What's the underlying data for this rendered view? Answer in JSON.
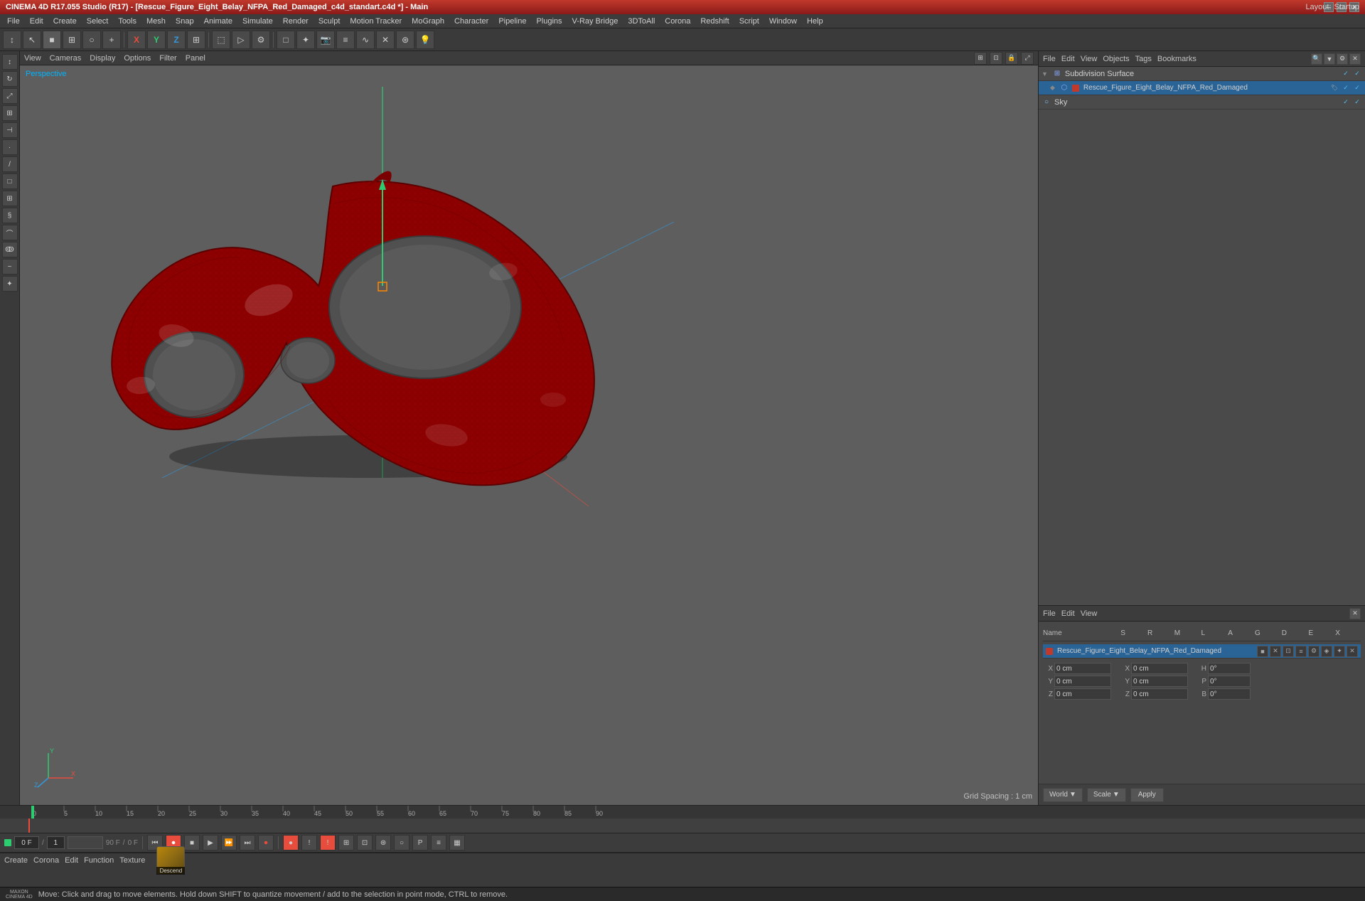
{
  "title_bar": {
    "title": "CINEMA 4D R17.055 Studio (R17) - [Rescue_Figure_Eight_Belay_NFPA_Red_Damaged_c4d_standart.c4d *] - Main",
    "layout_label": "Layout:",
    "layout_value": "Startup"
  },
  "menu_bar": {
    "items": [
      "File",
      "Edit",
      "Create",
      "Select",
      "Tools",
      "Mesh",
      "Snap",
      "Animate",
      "Simulate",
      "Render",
      "Sculpt",
      "Motion Tracker",
      "MoGraph",
      "Character",
      "Pipeline",
      "Plugins",
      "V-Ray Bridge",
      "3DToAll",
      "Corona",
      "Redshift",
      "Script",
      "Window",
      "Help"
    ]
  },
  "viewport": {
    "header_items": [
      "View",
      "Cameras",
      "Display",
      "Options",
      "Filter",
      "Panel"
    ],
    "perspective_label": "Perspective",
    "grid_spacing": "Grid Spacing : 1 cm"
  },
  "right_panel_top": {
    "header_items": [
      "File",
      "Edit",
      "View",
      "Objects",
      "Tags",
      "Bookmarks"
    ],
    "object_tree": {
      "items": [
        {
          "name": "Subdivision Surface",
          "indent": 0,
          "icon": "▽",
          "color": null,
          "active": true
        },
        {
          "name": "Rescue_Figure_Eight_Belay_NFPA_Red_Damaged",
          "indent": 1,
          "icon": "◆",
          "color": "#c0392b",
          "active": true
        },
        {
          "name": "Sky",
          "indent": 0,
          "icon": "○",
          "color": null,
          "active": true
        }
      ]
    }
  },
  "right_panel_bottom": {
    "header_items": [
      "File",
      "Edit",
      "View"
    ],
    "columns": {
      "name": "Name",
      "s": "S",
      "r": "R",
      "m": "M",
      "l": "L",
      "a": "A",
      "g": "G",
      "d": "D",
      "e": "E",
      "x": "X"
    },
    "selected_object": "Rescue_Figure_Eight_Belay_NFPA_Red_Damaged",
    "coords": {
      "x_label": "X",
      "y_label": "Y",
      "z_label": "Z",
      "x_pos": "0 cm",
      "y_pos": "0 cm",
      "z_pos": "0 cm",
      "x_rot": "0 cm",
      "y_rot": "0 cm",
      "z_rot": "0 cm",
      "h_label": "H",
      "p_label": "P",
      "b_label": "B",
      "h_val": "0°",
      "p_val": "0°",
      "b_val": "0°"
    }
  },
  "bottom_coord_bar": {
    "world_label": "World",
    "scale_label": "Scale",
    "apply_label": "Apply"
  },
  "timeline": {
    "start_frame": "0 F",
    "current_frame": "0",
    "end_frame": "90 F",
    "fps_value": "0 F",
    "ruler_marks": [
      "0",
      "5",
      "10",
      "15",
      "20",
      "25",
      "30",
      "35",
      "40",
      "45",
      "50",
      "55",
      "60",
      "65",
      "70",
      "75",
      "80",
      "85",
      "90"
    ]
  },
  "transport": {
    "frame_input": "0",
    "frame_step": "1",
    "end_frame": "90 F",
    "fps_display": "0 F",
    "buttons": {
      "to_start": "⏮",
      "play_back": "◀",
      "stop": "■",
      "play_fwd": "▶",
      "play_back2": "◀▶",
      "to_end": "⏭",
      "record": "⏺"
    }
  },
  "material_bar": {
    "menu_items": [
      "Create",
      "Corona",
      "Edit",
      "Function",
      "Texture"
    ],
    "material_name": "Descend"
  },
  "status_bar": {
    "message": "Move: Click and drag to move elements. Hold down SHIFT to quantize movement / add to the selection in point mode, CTRL to remove."
  },
  "colors": {
    "title_bar_gradient_start": "#c0392b",
    "title_bar_gradient_end": "#8b1a1a",
    "object_color": "#c0392b",
    "accent_blue": "#2a6496",
    "viewport_bg": "#606060"
  }
}
